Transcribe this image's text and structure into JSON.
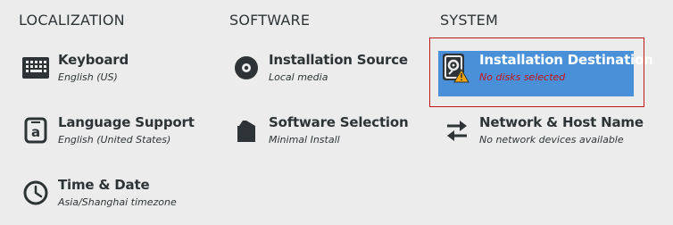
{
  "sections": {
    "localization": "LOCALIZATION",
    "software": "SOFTWARE",
    "system": "SYSTEM"
  },
  "spokes": {
    "keyboard": {
      "title": "Keyboard",
      "status": "English (US)",
      "icon": "keyboard-icon"
    },
    "language": {
      "title": "Language Support",
      "status": "English (United States)",
      "icon": "language-icon"
    },
    "time": {
      "title": "Time & Date",
      "status": "Asia/Shanghai timezone",
      "icon": "clock-icon"
    },
    "source": {
      "title": "Installation Source",
      "status": "Local media",
      "icon": "disc-icon"
    },
    "selection": {
      "title": "Software Selection",
      "status": "Minimal Install",
      "icon": "package-icon"
    },
    "destination": {
      "title": "Installation Destination",
      "status": "No disks selected",
      "icon": "harddisk-warning-icon"
    },
    "network": {
      "title": "Network & Host Name",
      "status": "No network devices available",
      "icon": "network-arrows-icon"
    }
  },
  "colors": {
    "background": "#ececec",
    "selected_fill": "#4a90d9",
    "warning_text": "#c4151b",
    "frame": "#c4151b",
    "warning_icon": "#f0a30a"
  }
}
